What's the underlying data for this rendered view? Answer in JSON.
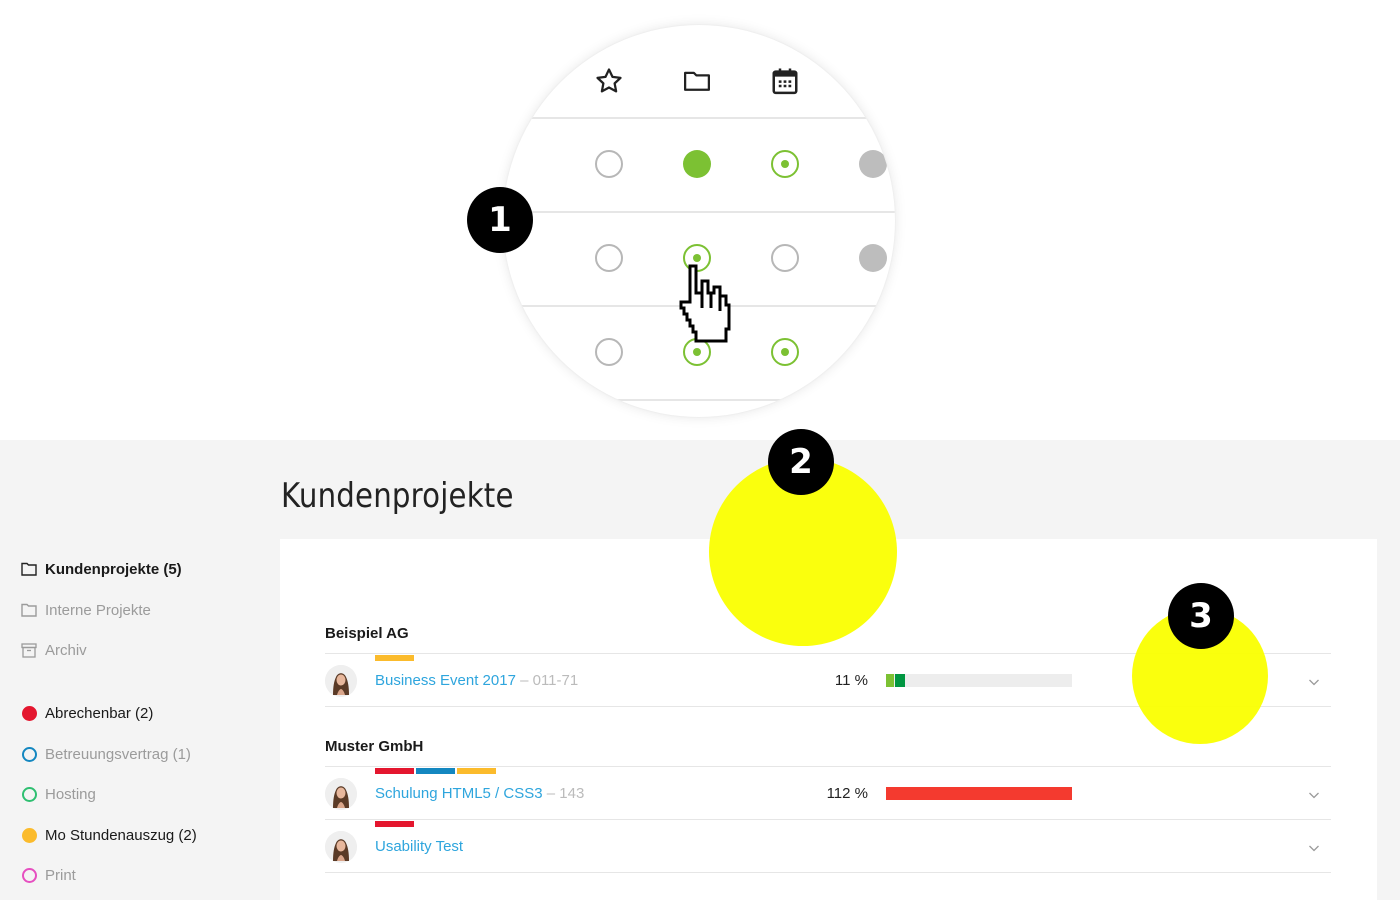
{
  "magnifier": {
    "header_icons": [
      "star-icon",
      "folder-icon",
      "calendar-icon"
    ],
    "rows": [
      [
        "empty",
        "filled-green",
        "dot-green",
        "filled-grey"
      ],
      [
        "empty",
        "dot-green",
        "empty",
        "filled-grey"
      ],
      [
        "empty",
        "dot-green",
        "dot-green",
        "none"
      ]
    ]
  },
  "callouts": [
    "1",
    "2",
    "3"
  ],
  "colors": {
    "accent_green": "#7cc133",
    "link_blue": "#2ea5dd",
    "tag_red": "#e4162e",
    "tag_blue": "#1487c0",
    "tag_yellow": "#fbbb2c",
    "progress_red": "#f43a2f",
    "progress_green_light": "#7cc133",
    "progress_green_dark": "#009641",
    "highlight_yellow": "#faff00"
  },
  "page": {
    "title": "Kundenprojekte"
  },
  "sidebar": {
    "folders": [
      {
        "label": "Kundenprojekte (5)",
        "icon": "folder-icon",
        "state": "active"
      },
      {
        "label": "Interne Projekte",
        "icon": "folder-icon",
        "state": "muted"
      },
      {
        "label": "Archiv",
        "icon": "archive-icon",
        "state": "muted"
      }
    ],
    "tags": [
      {
        "label": "Abrechenbar (2)",
        "color": "#e4162e",
        "filled": true,
        "state": "dark"
      },
      {
        "label": "Betreuungsvertrag (1)",
        "color": "#1487c0",
        "filled": false,
        "state": "muted"
      },
      {
        "label": "Hosting",
        "color": "#2fbf71",
        "filled": false,
        "state": "muted"
      },
      {
        "label": "Mo Stundenauszug (2)",
        "color": "#fbbb2c",
        "filled": true,
        "state": "dark"
      },
      {
        "label": "Print",
        "color": "#e64fc0",
        "filled": false,
        "state": "muted"
      }
    ]
  },
  "groups": [
    {
      "name": "Beispiel AG",
      "projects": [
        {
          "title": "Business Event 2017",
          "code": " – 011-71",
          "tags": [
            "#fbbb2c"
          ],
          "percent_label": "11 %",
          "progress": 0.11,
          "progress_segments": [
            {
              "color": "#7cc133",
              "fraction": 0.05
            },
            {
              "color": "#009641",
              "fraction": 0.06
            }
          ]
        }
      ]
    },
    {
      "name": "Muster GmbH",
      "projects": [
        {
          "title": "Schulung HTML5 / CSS3",
          "code": " – 143",
          "tags": [
            "#e4162e",
            "#1487c0",
            "#fbbb2c"
          ],
          "percent_label": "112 %",
          "progress": 1.12,
          "progress_segments": [
            {
              "color": "#f43a2f",
              "fraction": 1.0
            }
          ]
        },
        {
          "title": "Usability Test",
          "code": "",
          "tags": [
            "#e4162e"
          ],
          "percent_label": "",
          "progress": null,
          "progress_segments": []
        }
      ]
    }
  ]
}
